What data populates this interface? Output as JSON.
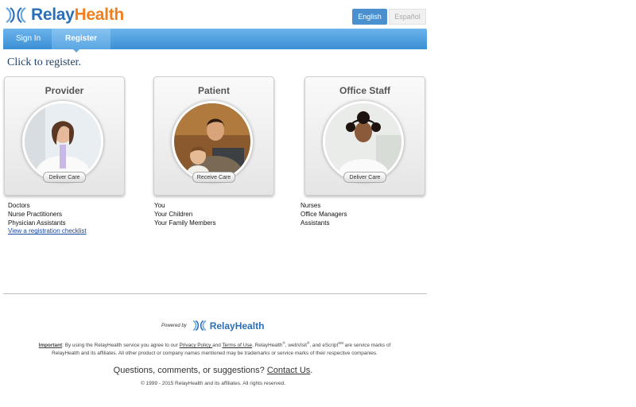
{
  "brand": {
    "relay": "Relay",
    "health": "Health"
  },
  "language": {
    "english": "English",
    "espanol": "Español"
  },
  "nav": {
    "signin": "Sign In",
    "register": "Register"
  },
  "intro": "Click to register.",
  "cards": [
    {
      "title": "Provider",
      "button": "Deliver Care",
      "items": [
        "Doctors",
        "Nurse Practitioners",
        "Physician Assistants"
      ],
      "link": "View a registration checklist"
    },
    {
      "title": "Patient",
      "button": "Receive Care",
      "items": [
        "You",
        "Your Children",
        "Your Family Members"
      ]
    },
    {
      "title": "Office Staff",
      "button": "Deliver Care",
      "items": [
        "Nurses",
        "Office Managers",
        "Assistants"
      ]
    }
  ],
  "footer": {
    "powered_by": "Powered by",
    "important": "Important",
    "legal_1": ": By using the RelayHealth service you agree to our ",
    "privacy": "Privacy Policy ",
    "and": "and ",
    "terms": "Terms of Use",
    "legal_2": ". RelayHealth",
    "reg": "®",
    "legal_3": ", webVisit",
    "legal_4": ", and eScript",
    "sm": "SM",
    "legal_5": " are service marks of RelayHealth and its affiliates. All other product or company names mentioned may be trademarks or service marks of their respective companies.",
    "questions": "Questions, comments, or suggestions? ",
    "contact": "Contact Us",
    "period": ".",
    "copyright": "© 1999 - 2015 RelayHealth and its affiliates. All rights reserved."
  },
  "colors": {
    "brand_blue": "#2a6fb7",
    "brand_orange": "#f07f1e",
    "nav_blue": "#3b8fd5"
  }
}
